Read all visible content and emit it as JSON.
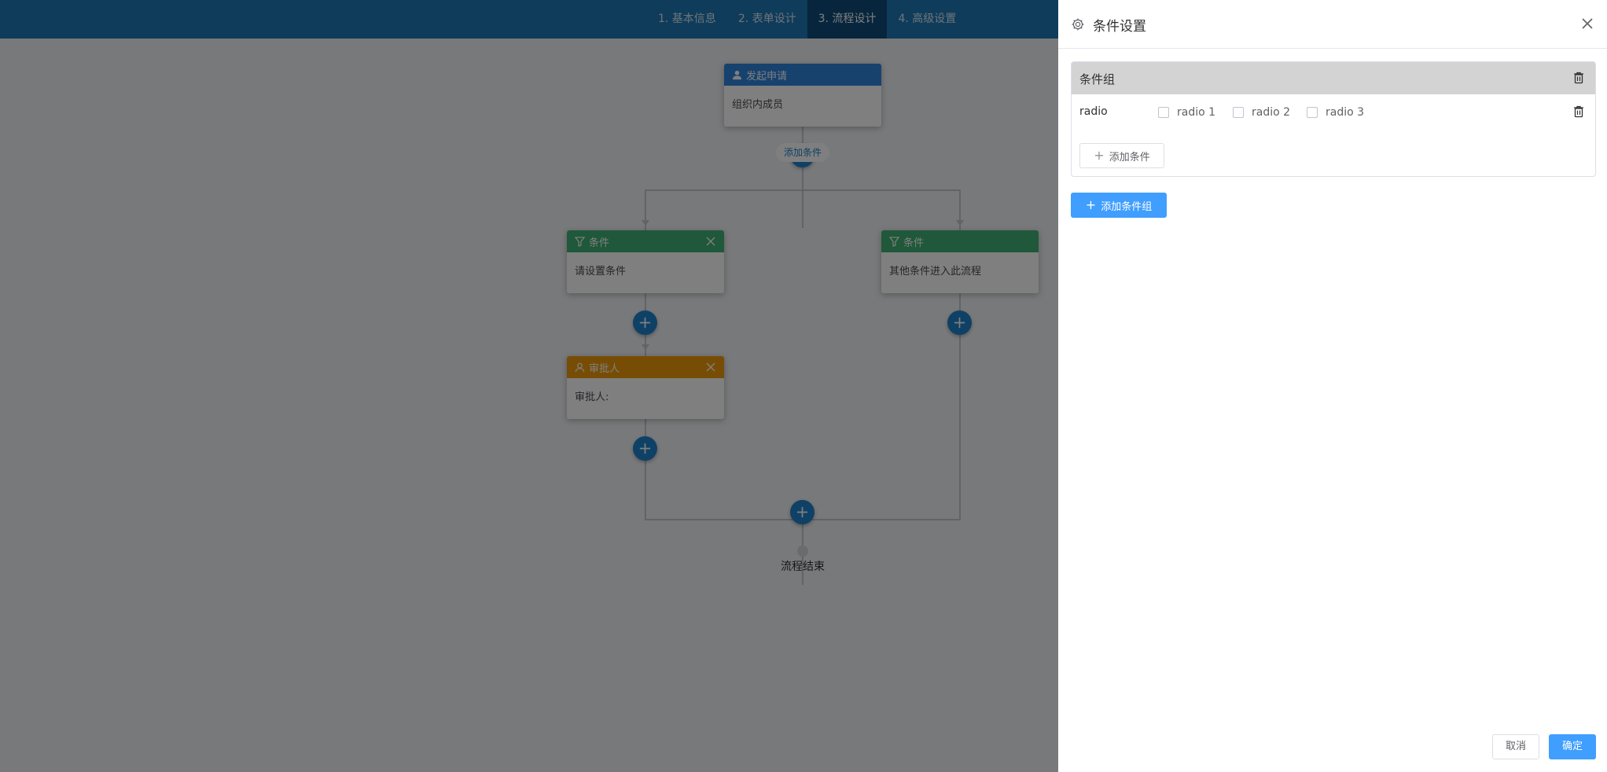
{
  "header": {
    "steps": [
      {
        "label": "1. 基本信息",
        "active": false
      },
      {
        "label": "2. 表单设计",
        "active": false
      },
      {
        "label": "3. 流程设计",
        "active": true
      },
      {
        "label": "4. 高级设置",
        "active": false
      }
    ]
  },
  "flow": {
    "start_node": {
      "title": "发起申请",
      "content": "组织内成员"
    },
    "add_condition_label": "添加条件",
    "condition_left": {
      "title": "条件",
      "content": "请设置条件"
    },
    "condition_right": {
      "title": "条件",
      "content": "其他条件进入此流程"
    },
    "approver_node": {
      "title": "审批人",
      "content": "审批人:"
    },
    "end_label": "流程结束"
  },
  "drawer": {
    "title": "条件设置",
    "group_title": "条件组",
    "condition_field": "radio",
    "options": [
      "radio 1",
      "radio 2",
      "radio 3"
    ],
    "add_condition_label": "添加条件",
    "add_group_label": "添加条件组",
    "cancel_label": "取消",
    "confirm_label": "确定"
  },
  "colors": {
    "header_bg": "#1f78b4",
    "primary": "#409eff",
    "start_node": "#2f84dd",
    "condition_node": "#3fb174",
    "approver_node": "#ef9a0b"
  }
}
